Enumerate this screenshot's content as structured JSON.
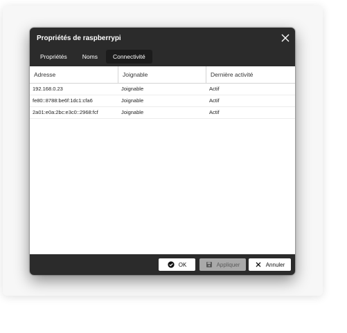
{
  "window": {
    "title": "Propriétés de raspberrypi"
  },
  "tabs": [
    {
      "label": "Propriétés",
      "active": false
    },
    {
      "label": "Noms",
      "active": false
    },
    {
      "label": "Connectivité",
      "active": true
    }
  ],
  "table": {
    "columns": [
      "Adresse",
      "Joignable",
      "Dernière activité"
    ],
    "rows": [
      [
        "192.168.0.23",
        "Joignable",
        "Actif"
      ],
      [
        "fe80::8788:be6f:1dc1:cfa6",
        "Joignable",
        "Actif"
      ],
      [
        "2a01:e0a:2bc:e3c0::2968:fcf",
        "Joignable",
        "Actif"
      ]
    ]
  },
  "footer": {
    "ok_label": "OK",
    "apply_label": "Appliquer",
    "cancel_label": "Annuler"
  },
  "colors": {
    "dialog_bg": "#2b2b2b",
    "active_tab_bg": "#1c1c1c",
    "disabled_button_bg": "#a9a9a9"
  },
  "icons": {
    "close": "close-icon",
    "ok": "check-circle-icon",
    "apply": "save-icon",
    "cancel": "x-icon"
  }
}
